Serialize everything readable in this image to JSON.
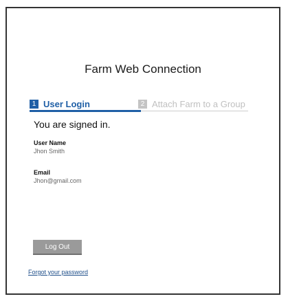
{
  "page": {
    "title": "Farm Web Connection"
  },
  "steps": [
    {
      "number": "1",
      "label": "User Login",
      "active": true
    },
    {
      "number": "2",
      "label": "Attach Farm to a Group",
      "active": false
    }
  ],
  "status": {
    "message": "You are signed in."
  },
  "user": {
    "name_label": "User Name",
    "name_value": "Jhon Smith",
    "email_label": "Email",
    "email_value": "Jhon@gmail.com"
  },
  "actions": {
    "logout_label": "Log Out",
    "forgot_password_label": "Forgot your password"
  },
  "colors": {
    "accent": "#1f5fa6",
    "inactive_step": "#c4c4c4",
    "button": "#9a9a9a"
  }
}
